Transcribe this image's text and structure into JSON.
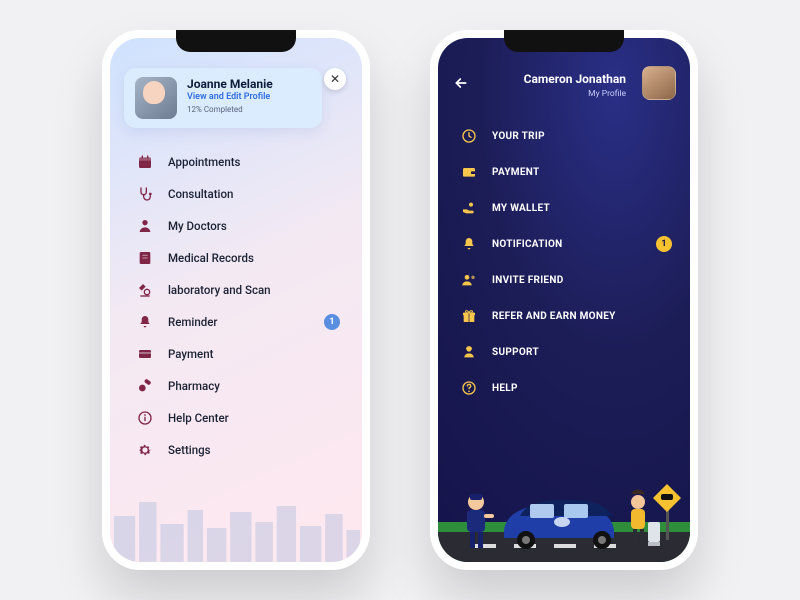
{
  "phoneA": {
    "profile": {
      "name": "Joanne Melanie",
      "subtitle": "View and Edit Profile",
      "progress": "12% Completed"
    },
    "closeGlyph": "✕",
    "menu": [
      {
        "label": "Appointments",
        "icon": "calendar"
      },
      {
        "label": "Consultation",
        "icon": "stethoscope"
      },
      {
        "label": "My Doctors",
        "icon": "doctor"
      },
      {
        "label": "Medical Records",
        "icon": "records"
      },
      {
        "label": "laboratory and Scan",
        "icon": "microscope"
      },
      {
        "label": "Reminder",
        "icon": "bell",
        "badge": "1"
      },
      {
        "label": "Payment",
        "icon": "card"
      },
      {
        "label": "Pharmacy",
        "icon": "pills"
      },
      {
        "label": "Help Center",
        "icon": "info"
      },
      {
        "label": "Settings",
        "icon": "gear"
      }
    ]
  },
  "phoneB": {
    "header": {
      "name": "Cameron Jonathan",
      "subtitle": "My Profile"
    },
    "menu": [
      {
        "label": "YOUR TRIP",
        "icon": "clock"
      },
      {
        "label": "PAYMENT",
        "icon": "wallet"
      },
      {
        "label": "MY WALLET",
        "icon": "hand-coin"
      },
      {
        "label": "NOTIFICATION",
        "icon": "bell",
        "badge": "1"
      },
      {
        "label": "INVITE FRIEND",
        "icon": "friend"
      },
      {
        "label": "REFER AND EARN MONEY",
        "icon": "gift"
      },
      {
        "label": "SUPPORT",
        "icon": "support"
      },
      {
        "label": "HELP",
        "icon": "help"
      }
    ]
  },
  "colors": {
    "accentA": "#7f2646",
    "accentB": "#f7c64a",
    "badgeA": "#5a8ee0",
    "badgeB": "#f7c230"
  }
}
